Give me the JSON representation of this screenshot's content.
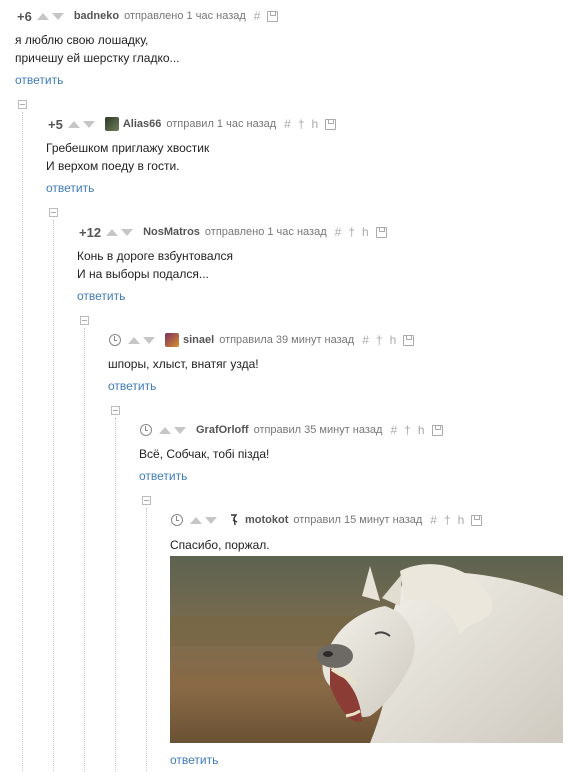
{
  "comments": [
    {
      "rating": "+6",
      "author": "badneko",
      "time": "отправлено 1 час назад",
      "lines": [
        "я люблю свою лошадку,",
        "причешу ей шерстку гладко..."
      ],
      "reply": "ответить"
    },
    {
      "rating": "+5",
      "author": "Alias66",
      "time": "отправил 1 час назад",
      "lines": [
        "Гребешком приглажу хвостик",
        "И верхом поеду в гости."
      ],
      "reply": "ответить"
    },
    {
      "rating": "+12",
      "author": "NosMatros",
      "time": "отправлено 1 час назад",
      "lines": [
        "Конь в дороге взбунтовался",
        "И на выборы подался..."
      ],
      "reply": "ответить"
    },
    {
      "author": "sinael",
      "time": "отправила 39 минут назад",
      "lines": [
        "шпоры, хлыст, внатяг узда!"
      ],
      "reply": "ответить"
    },
    {
      "author": "GrafOrloff",
      "time": "отправил 35 минут назад",
      "lines": [
        "Всё, Собчак, тобі пізда!"
      ],
      "reply": "ответить"
    },
    {
      "author": "motokot",
      "time": "отправил 15 минут назад",
      "lines": [
        "Спасибо, поржал."
      ],
      "reply": "ответить"
    }
  ],
  "icons": {
    "hash": "#",
    "up": "†",
    "branch": "h"
  },
  "colors": {
    "link": "#3f7bb8",
    "text": "#222222",
    "meta": "#777777"
  }
}
